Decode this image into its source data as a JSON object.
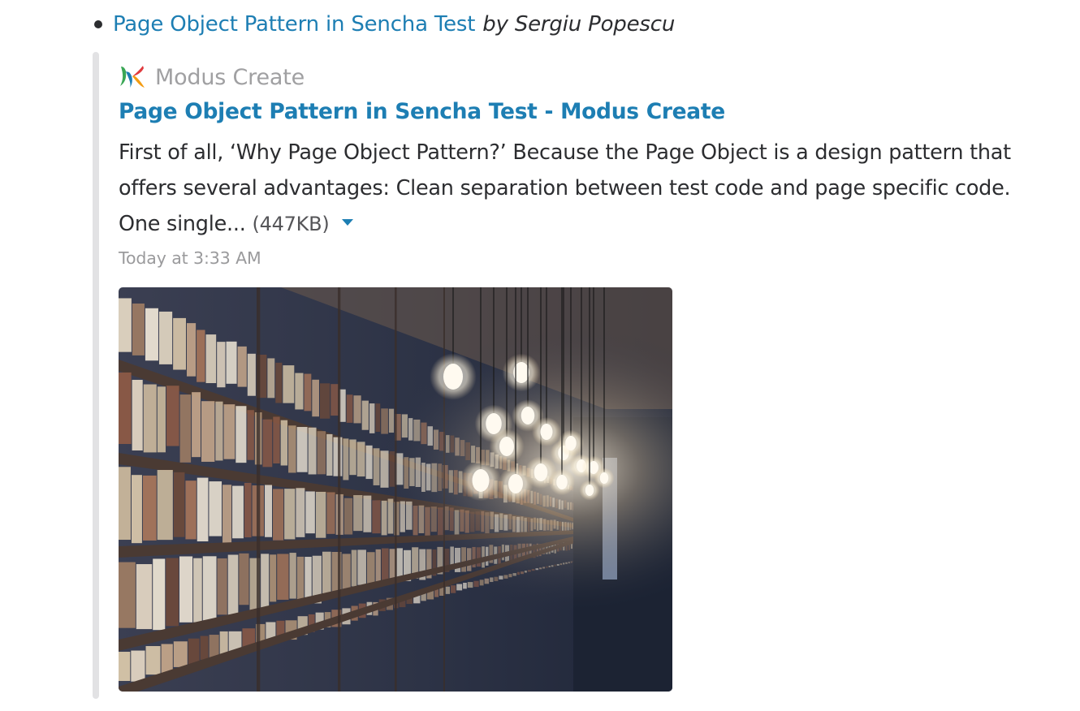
{
  "item": {
    "link_text": "Page Object Pattern in Sencha Test",
    "byline": "by Sergiu Popescu"
  },
  "attachment": {
    "service_name": "Modus Create",
    "service_icon": "modus-create-logo-icon",
    "title": "Page Object Pattern in Sencha Test - Modus Create",
    "text": "First of all, ‘Why Page Object Pattern?’ Because the Page Object is a design pattern that offers several advantages: Clean separation between test code and page specific code. One single...",
    "file_size": "(447KB)",
    "timestamp": "Today at 3:33 AM",
    "image_description": "library-bookshelves-with-hanging-light-bulbs",
    "colors": {
      "link": "#1d7eb3",
      "bar": "#e2e2e4",
      "muted": "#a0a0a2"
    }
  }
}
